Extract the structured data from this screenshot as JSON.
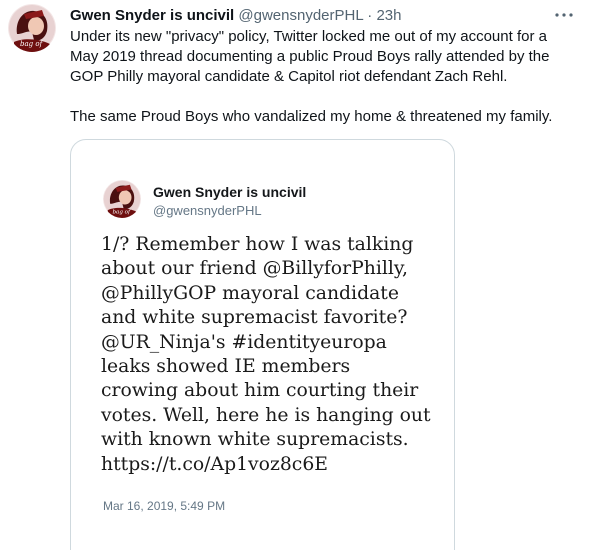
{
  "tweet": {
    "author_name": "Gwen Snyder is uncivil",
    "author_handle": "@gwensnyderPHL",
    "separator": "·",
    "time": "23h",
    "more_icon": "more-icon",
    "avatar_icon": "avatar-image",
    "text_line1": "Under its new \"privacy\" policy, Twitter locked me out of my account for a May 2019 thread documenting a public Proud Boys rally attended by the GOP Philly mayoral candidate & Capitol riot defendant Zach Rehl.",
    "text_line2": "The same Proud Boys who vandalized my home & threatened my family."
  },
  "embedded": {
    "author_name": "Gwen Snyder is uncivil",
    "author_handle": "@gwensnyderPHL",
    "text": "1/? Remember how I was talking\nabout our friend @BillyforPhilly,\n@PhillyGOP mayoral candidate\nand white supremacist favorite?\n@UR_Ninja's #identityeuropa\nleaks showed IE members\ncrowing about him courting their\nvotes. Well, here he is hanging out\nwith known white supremacists.\nhttps://t.co/Ap1voz8c6E",
    "date": "Mar 16, 2019, 5:49 PM"
  },
  "colors": {
    "text": "#0f1419",
    "secondary": "#536471",
    "border": "#cfd9de"
  }
}
